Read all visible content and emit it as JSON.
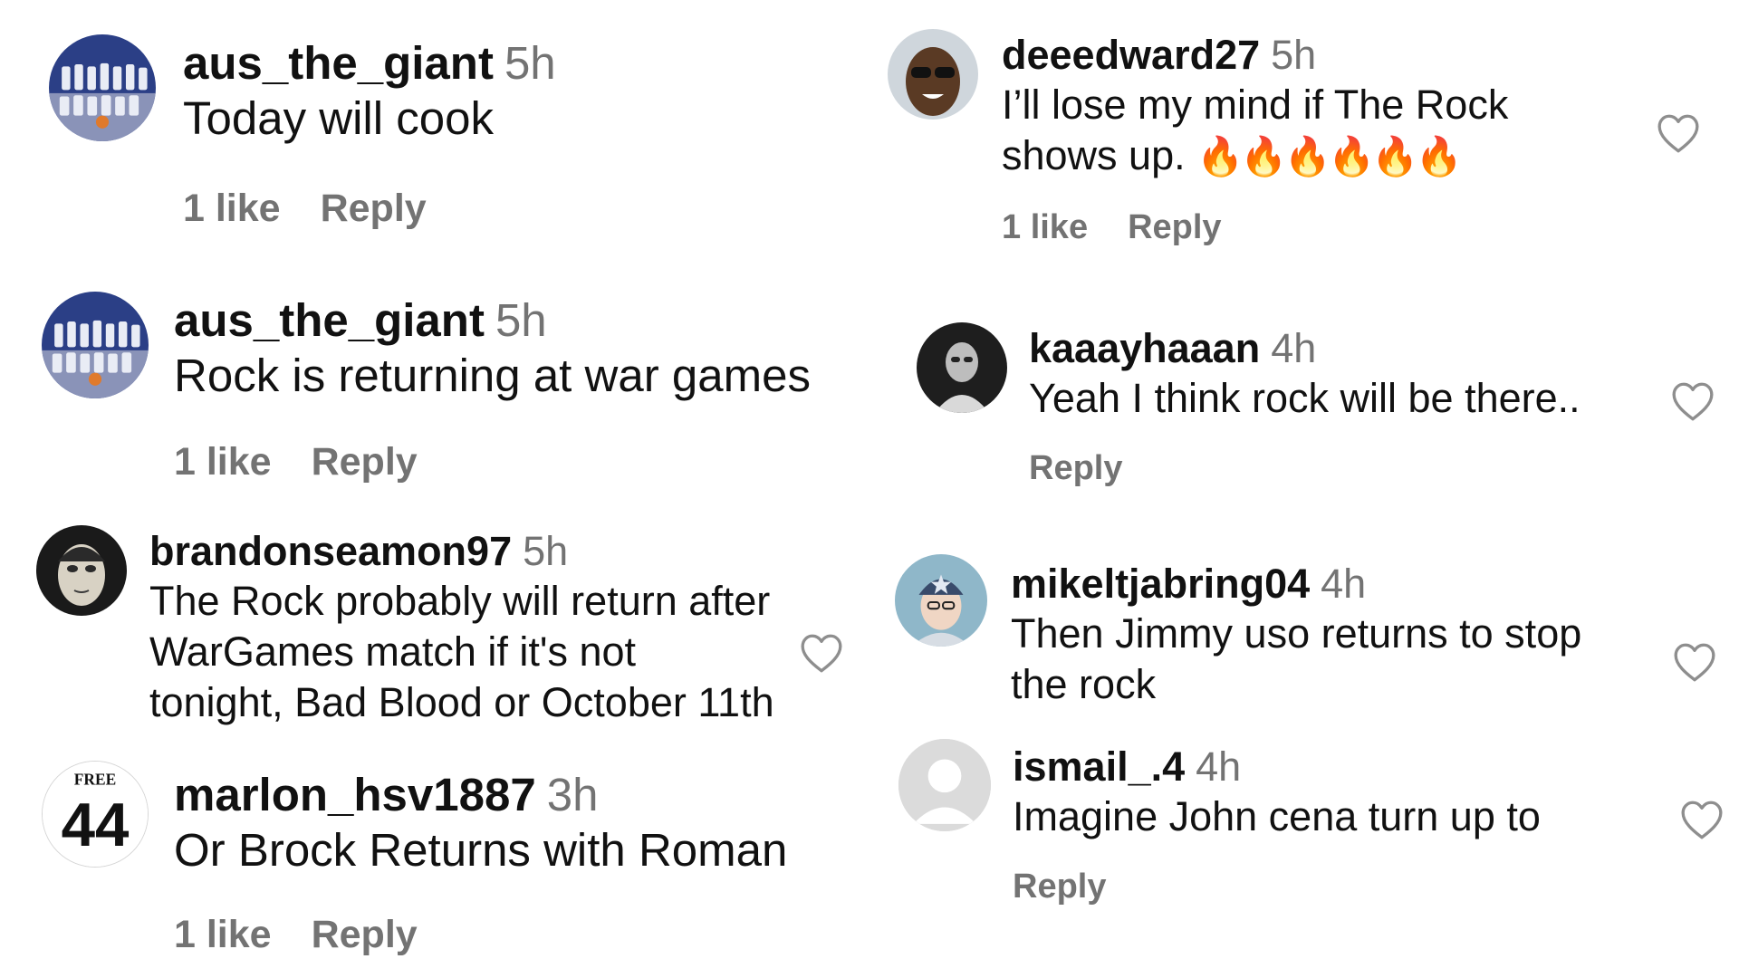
{
  "comments_left": [
    {
      "username": "aus_the_giant",
      "time": "5h",
      "text": [
        "Today will cook"
      ],
      "likes": "1 like",
      "reply": "Reply",
      "avatar": "team-photo-avatar"
    },
    {
      "username": "aus_the_giant",
      "time": "5h",
      "text": [
        "Rock is returning at war games"
      ],
      "likes": "1 like",
      "reply": "Reply",
      "avatar": "team-photo-avatar"
    },
    {
      "username": "brandonseamon97",
      "time": "5h",
      "text": [
        "The Rock probably will return after",
        "WarGames match if it's not",
        "tonight, Bad Blood or October 11th"
      ],
      "avatar": "masked-face-avatar"
    },
    {
      "username": "marlon_hsv1887",
      "time": "3h",
      "text": [
        "Or Brock Returns with Roman"
      ],
      "likes": "1 like",
      "reply": "Reply",
      "avatar": "free-44-avatar",
      "avatar_text_top": "FREE",
      "avatar_text_num": "44"
    }
  ],
  "comments_right": [
    {
      "username": "deeedward27",
      "time": "5h",
      "text": [
        "I’ll lose my mind if The Rock",
        "shows up."
      ],
      "emoji": "🔥🔥🔥🔥🔥🔥",
      "likes": "1 like",
      "reply": "Reply",
      "avatar": "sunglasses-man-avatar"
    },
    {
      "username": "kaaayhaaan",
      "time": "4h",
      "text": [
        "Yeah I think rock will be there.."
      ],
      "reply": "Reply",
      "avatar": "bw-portrait-avatar"
    },
    {
      "username": "mikeltjabring04",
      "time": "4h",
      "text": [
        "Then Jimmy uso returns to stop",
        "the rock"
      ],
      "avatar": "cap-boy-avatar"
    },
    {
      "username": "ismail_.4",
      "time": "4h",
      "text": [
        "Imagine John cena turn up to"
      ],
      "reply": "Reply",
      "avatar": "default-user-avatar"
    }
  ],
  "colors": {
    "text": "#111111",
    "muted": "#737373",
    "heart_stroke": "#8e8e8e"
  }
}
